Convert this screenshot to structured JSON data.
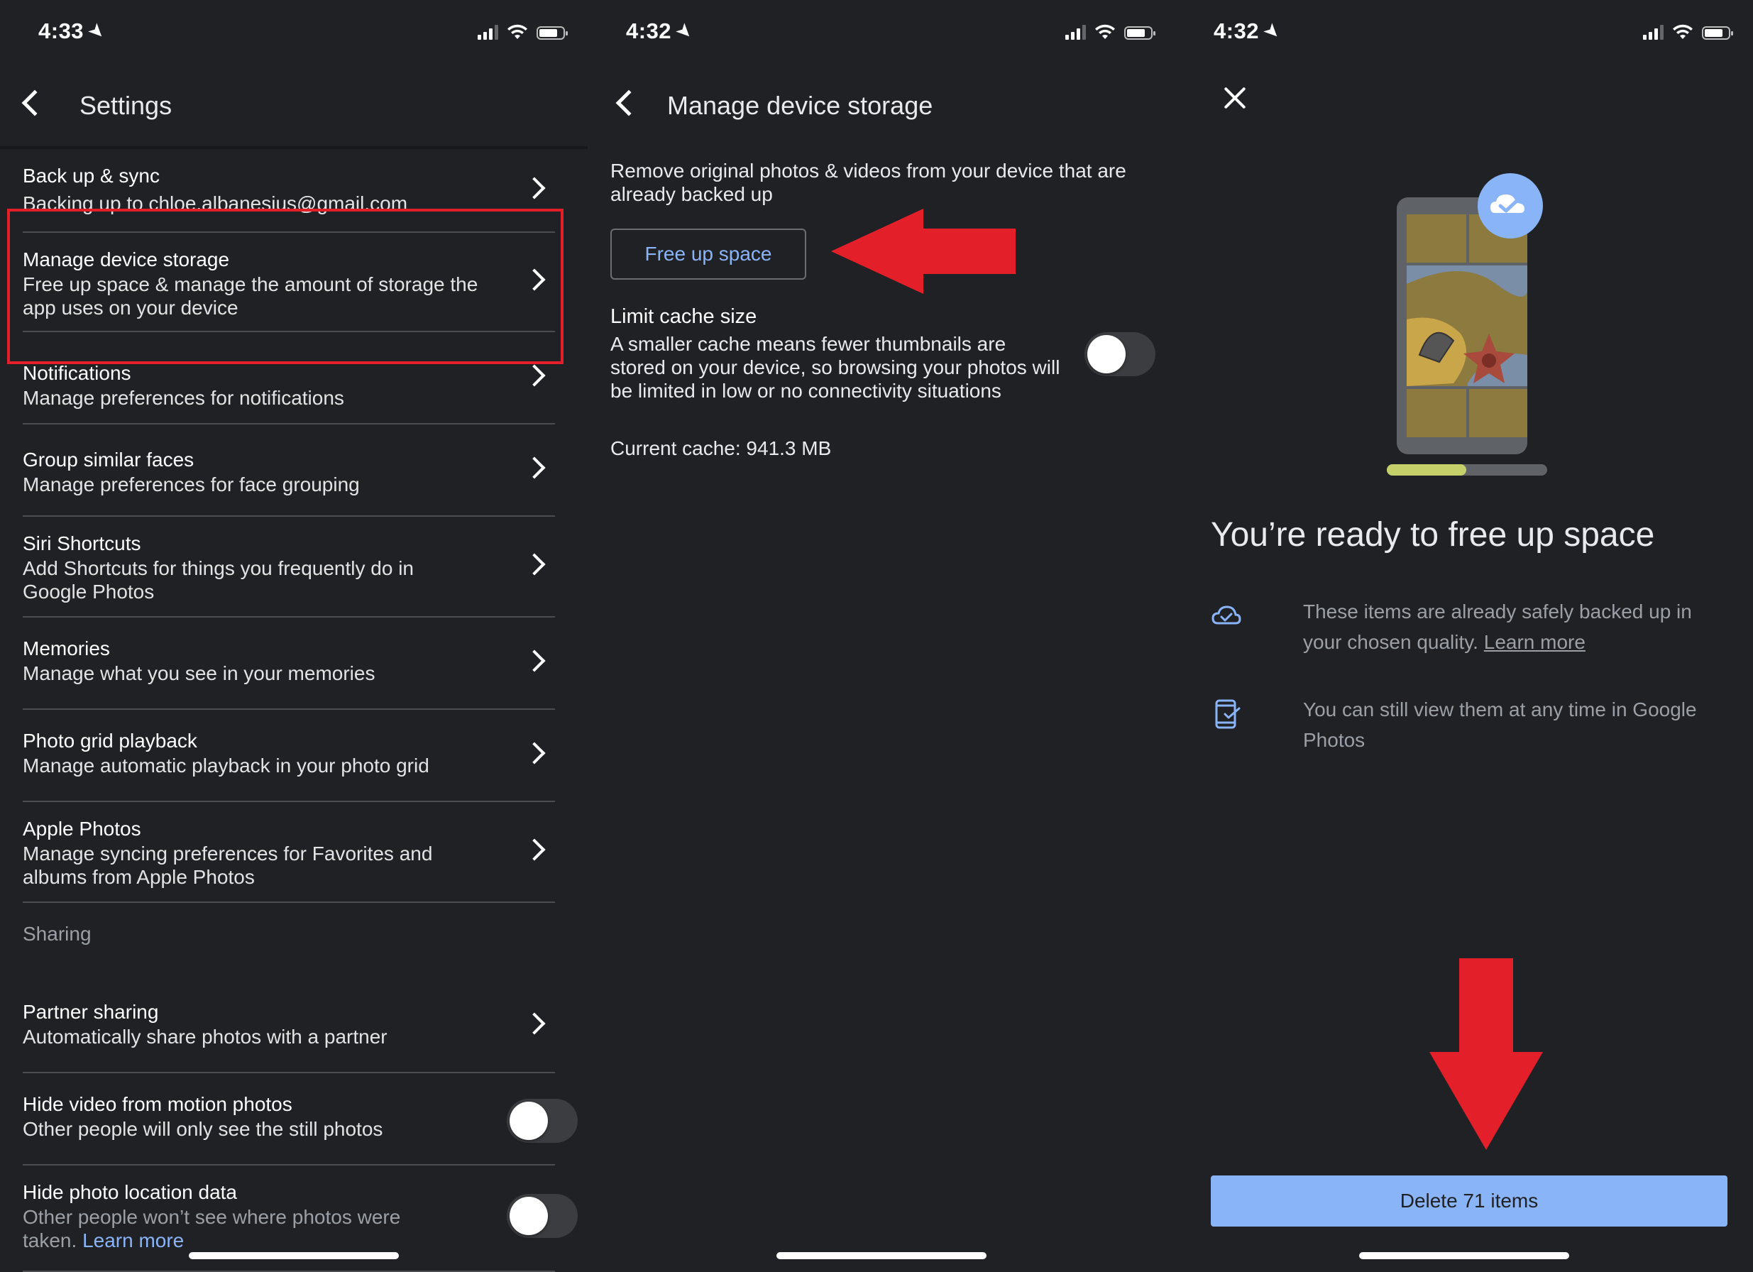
{
  "panels": [
    {
      "status_bar": {
        "time": "4:33"
      },
      "header": {
        "title": "Settings"
      },
      "items": [
        {
          "title": "Back up & sync",
          "subtitle": "Backing up to chloe.albanesius@gmail.com"
        },
        {
          "title": "Manage device storage",
          "subtitle": "Free up space & manage the amount of storage the app uses on your device"
        },
        {
          "title": "Notifications",
          "subtitle": "Manage preferences for notifications"
        },
        {
          "title": "Group similar faces",
          "subtitle": "Manage preferences for face grouping"
        },
        {
          "title": "Siri Shortcuts",
          "subtitle": "Add Shortcuts for things you frequently do in Google Photos"
        },
        {
          "title": "Memories",
          "subtitle": "Manage what you see in your memories"
        },
        {
          "title": "Photo grid playback",
          "subtitle": "Manage automatic playback in your photo grid"
        },
        {
          "title": "Apple Photos",
          "subtitle": "Manage syncing preferences for Favorites and albums from Apple Photos"
        }
      ],
      "section_sharing": "Sharing",
      "sharing_items": [
        {
          "title": "Partner sharing",
          "subtitle": "Automatically share photos with a partner"
        },
        {
          "title": "Hide video from motion photos",
          "subtitle": "Other people will only see the still photos"
        },
        {
          "title": "Hide photo location data",
          "subtitle": "Other people won’t see where photos were taken.",
          "link": "Learn more"
        }
      ]
    },
    {
      "status_bar": {
        "time": "4:32"
      },
      "header": {
        "title": "Manage device storage"
      },
      "description": "Remove original photos & videos from your device that are already backed up",
      "free_up_button": "Free up space",
      "cache": {
        "title": "Limit cache size",
        "description": "A smaller cache means fewer thumbnails are stored on your device, so browsing your photos will be limited in low or no connectivity situations",
        "current": "Current cache: 941.3 MB",
        "toggle_on": false
      }
    },
    {
      "status_bar": {
        "time": "4:32"
      },
      "title": "You’re ready to free up space",
      "info": [
        {
          "icon": "cloud-check-icon",
          "text": "These items are already safely backed up in your chosen quality.",
          "link": "Learn more"
        },
        {
          "icon": "phone-check-icon",
          "text": "You can still view them at any time in Google Photos"
        }
      ],
      "delete_button": "Delete 71 items"
    }
  ],
  "colors": {
    "background": "#202124",
    "accent_blue": "#8ab4f8",
    "annotation_red": "#e3202a"
  }
}
